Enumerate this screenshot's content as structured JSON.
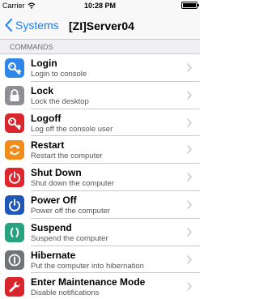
{
  "status_bar": {
    "carrier": "Carrier",
    "time": "10:28 PM"
  },
  "nav": {
    "back_label": "Systems",
    "title": "[ZI]Server04"
  },
  "section": {
    "title": "COMMANDS"
  },
  "commands": [
    {
      "title": "Login",
      "subtitle": "Login to console",
      "icon": "key-icon",
      "color": "#2f87e8"
    },
    {
      "title": "Lock",
      "subtitle": "Lock the desktop",
      "icon": "lock-icon",
      "color": "#8e8e93"
    },
    {
      "title": "Logoff",
      "subtitle": "Log off the console user",
      "icon": "key-icon",
      "color": "#d9262c"
    },
    {
      "title": "Restart",
      "subtitle": "Restart the computer",
      "icon": "restart-icon",
      "color": "#f08c1a"
    },
    {
      "title": "Shut Down",
      "subtitle": "Shut down the computer",
      "icon": "power-icon",
      "color": "#e0262c"
    },
    {
      "title": "Power Off",
      "subtitle": "Power off the computer",
      "icon": "power-icon",
      "color": "#1f57b8"
    },
    {
      "title": "Suspend",
      "subtitle": "Suspend the computer",
      "icon": "suspend-icon",
      "color": "#27a37f"
    },
    {
      "title": "Hibernate",
      "subtitle": "Put the computer into hibernation",
      "icon": "hibernate-icon",
      "color": "#6f7478"
    },
    {
      "title": "Enter Maintenance Mode",
      "subtitle": "Disable notifications",
      "icon": "wrench-icon",
      "color": "#d9262c"
    }
  ]
}
